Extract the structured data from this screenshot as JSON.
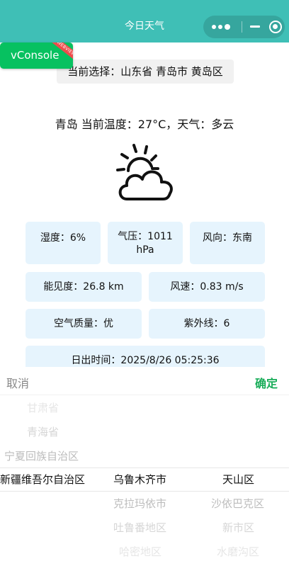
{
  "navbar": {
    "title": "今日天气"
  },
  "vconsole": {
    "label": "vConsole",
    "ribbon": "WEBVIEW"
  },
  "selection": {
    "text": "当前选择：山东省 青岛市 黄岛区"
  },
  "weather": {
    "summary": "青岛 当前温度：27°C，天气：多云",
    "icon": "partly-cloudy-icon"
  },
  "cards": {
    "humidity": "湿度：6%",
    "pressure_line1": "气压：1011",
    "pressure_line2": "hPa",
    "wind_direction": "风向：东南",
    "visibility": "能见度：26.8 km",
    "wind_speed": "风速：0.83 m/s",
    "air_quality": "空气质量：优",
    "uv": "紫外线：6",
    "sunrise": "日出时间：2025/8/26 05:25:36"
  },
  "picker": {
    "cancel_label": "取消",
    "confirm_label": "确定",
    "provinces": [
      "甘肃省",
      "青海省",
      "宁夏回族自治区",
      "新疆维吾尔自治区"
    ],
    "cities": [
      "乌鲁木齐市",
      "克拉玛依市",
      "吐鲁番地区",
      "哈密地区"
    ],
    "districts": [
      "天山区",
      "沙依巴克区",
      "新市区",
      "水磨沟区"
    ]
  }
}
